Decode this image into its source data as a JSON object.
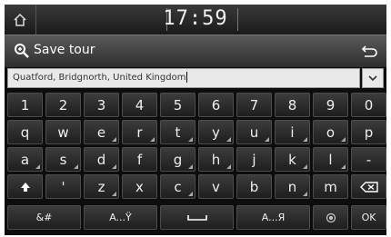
{
  "status_bar": {
    "time": "17:59"
  },
  "header": {
    "title": "Save tour"
  },
  "search": {
    "value": "Quatford, Bridgnorth, United Kingdom"
  },
  "keyboard": {
    "row1": [
      "1",
      "2",
      "3",
      "4",
      "5",
      "6",
      "7",
      "8",
      "9",
      "0"
    ],
    "row2": [
      "q",
      "w",
      "e",
      "r",
      "t",
      "y",
      "u",
      "i",
      "o",
      "p"
    ],
    "row3": [
      "a",
      "s",
      "d",
      "f",
      "g",
      "h",
      "j",
      "k",
      "l",
      "-"
    ],
    "row4": [
      "'",
      "z",
      "x",
      "c",
      "v",
      "b",
      "n",
      "m"
    ],
    "bottom": {
      "symbols": "&#",
      "lang1": "A...Ÿ",
      "lang2": "A...Я",
      "ok": "OK"
    }
  }
}
